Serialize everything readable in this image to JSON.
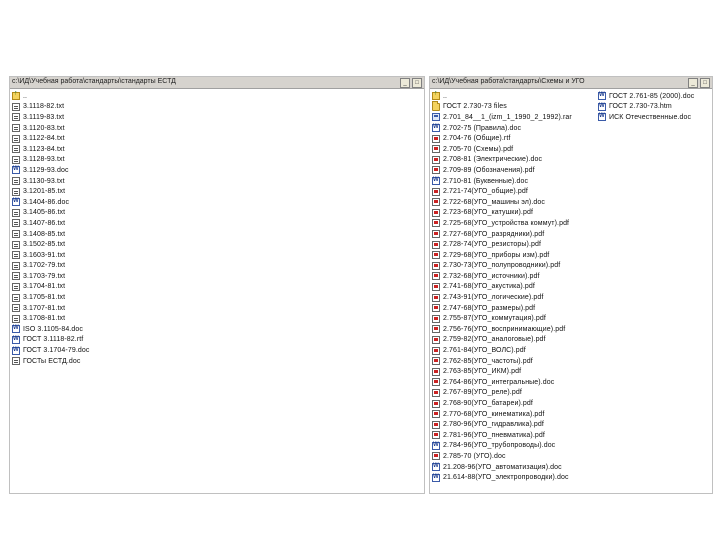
{
  "left_panel": {
    "path": "c:\\ИД\\Учебная работа\\стандарты\\стандарты ЕСТД",
    "items": [
      {
        "name": "..",
        "icon": "up-folder-icon"
      },
      {
        "name": "3.1118-82.txt",
        "icon": "text-file-icon"
      },
      {
        "name": "3.1119-83.txt",
        "icon": "text-file-icon"
      },
      {
        "name": "3.1120-83.txt",
        "icon": "text-file-icon"
      },
      {
        "name": "3.1122-84.txt",
        "icon": "text-file-icon"
      },
      {
        "name": "3.1123-84.txt",
        "icon": "text-file-icon"
      },
      {
        "name": "3.1128-93.txt",
        "icon": "text-file-icon"
      },
      {
        "name": "3.1129-93.doc",
        "icon": "word-doc-icon"
      },
      {
        "name": "3.1130-93.txt",
        "icon": "text-file-icon"
      },
      {
        "name": "3.1201-85.txt",
        "icon": "text-file-icon"
      },
      {
        "name": "3.1404-86.doc",
        "icon": "word-doc-icon"
      },
      {
        "name": "3.1405-86.txt",
        "icon": "text-file-icon"
      },
      {
        "name": "3.1407-86.txt",
        "icon": "text-file-icon"
      },
      {
        "name": "3.1408-85.txt",
        "icon": "text-file-icon"
      },
      {
        "name": "3.1502-85.txt",
        "icon": "text-file-icon"
      },
      {
        "name": "3.1603-91.txt",
        "icon": "text-file-icon"
      },
      {
        "name": "3.1702-79.txt",
        "icon": "text-file-icon"
      },
      {
        "name": "3.1703-79.txt",
        "icon": "text-file-icon"
      },
      {
        "name": "3.1704-81.txt",
        "icon": "text-file-icon"
      },
      {
        "name": "3.1705-81.txt",
        "icon": "text-file-icon"
      },
      {
        "name": "3.1707-81.txt",
        "icon": "text-file-icon"
      },
      {
        "name": "3.1708-81.txt",
        "icon": "text-file-icon"
      },
      {
        "name": "ISO 3.1105-84.doc",
        "icon": "word-doc-icon"
      },
      {
        "name": "ГОСТ 3.1118-82.rtf",
        "icon": "word-doc-icon"
      },
      {
        "name": "ГОСТ 3.1704-79.doc",
        "icon": "word-doc-icon"
      },
      {
        "name": "ГОСТы ЕСТД.doc",
        "icon": "text-file-icon"
      }
    ]
  },
  "right_panel": {
    "path": "c:\\ИД\\Учебная работа\\стандарты\\Схемы и УГО",
    "col1": [
      {
        "name": "..",
        "icon": "up-folder-icon"
      },
      {
        "name": "ГОСТ 2.730-73 files",
        "icon": "folder-icon"
      },
      {
        "name": "2.701_84__1_(izm_1_1990_2_1992).rar",
        "icon": "archive-icon"
      },
      {
        "name": "2.702-75 (Правила).doc",
        "icon": "word-doc-icon"
      },
      {
        "name": "2.704-76 (Общие).rtf",
        "icon": "pdf-icon"
      },
      {
        "name": "2.705-70 (Схемы).pdf",
        "icon": "pdf-icon"
      },
      {
        "name": "2.708-81 (Электрические).doc",
        "icon": "pdf-icon"
      },
      {
        "name": "2.709-89 (Обозначения).pdf",
        "icon": "pdf-icon"
      },
      {
        "name": "2.710-81 (Буквенные).doc",
        "icon": "word-doc-icon"
      },
      {
        "name": "2.721-74(УГО_общие).pdf",
        "icon": "pdf-icon"
      },
      {
        "name": "2.722-68(УГО_машины эл).doc",
        "icon": "pdf-icon"
      },
      {
        "name": "2.723-68(УГО_катушки).pdf",
        "icon": "pdf-icon"
      },
      {
        "name": "2.725-68(УГО_устройства коммут).pdf",
        "icon": "pdf-icon"
      },
      {
        "name": "2.727-68(УГО_разрядники).pdf",
        "icon": "pdf-icon"
      },
      {
        "name": "2.728-74(УГО_резисторы).pdf",
        "icon": "pdf-icon"
      },
      {
        "name": "2.729-68(УГО_приборы изм).pdf",
        "icon": "pdf-icon"
      },
      {
        "name": "2.730-73(УГО_полупроводники).pdf",
        "icon": "pdf-icon"
      },
      {
        "name": "2.732-68(УГО_источники).pdf",
        "icon": "pdf-icon"
      },
      {
        "name": "2.741-68(УГО_акустика).pdf",
        "icon": "pdf-icon"
      },
      {
        "name": "2.743-91(УГО_логические).pdf",
        "icon": "pdf-icon"
      },
      {
        "name": "2.747-68(УГО_размеры).pdf",
        "icon": "pdf-icon"
      },
      {
        "name": "2.755-87(УГО_коммутация).pdf",
        "icon": "pdf-icon"
      },
      {
        "name": "2.756-76(УГО_воспринимающие).pdf",
        "icon": "pdf-icon"
      },
      {
        "name": "2.759-82(УГО_аналоговые).pdf",
        "icon": "pdf-icon"
      },
      {
        "name": "2.761-84(УГО_ВОЛС).pdf",
        "icon": "pdf-icon"
      },
      {
        "name": "2.762-85(УГО_частоты).pdf",
        "icon": "pdf-icon"
      },
      {
        "name": "2.763-85(УГО_ИКМ).pdf",
        "icon": "pdf-icon"
      },
      {
        "name": "2.764-86(УГО_интегральные).doc",
        "icon": "pdf-icon"
      },
      {
        "name": "2.767-89(УГО_реле).pdf",
        "icon": "pdf-icon"
      },
      {
        "name": "2.768-90(УГО_батареи).pdf",
        "icon": "pdf-icon"
      },
      {
        "name": "2.770-68(УГО_кинематика).pdf",
        "icon": "pdf-icon"
      },
      {
        "name": "2.780-96(УГО_гидравлика).pdf",
        "icon": "pdf-icon"
      },
      {
        "name": "2.781-96(УГО_пневматика).pdf",
        "icon": "pdf-icon"
      },
      {
        "name": "2.784-96(УГО_трубопроводы).doc",
        "icon": "word-doc-icon"
      },
      {
        "name": "2.785-70 (УГО).doc",
        "icon": "pdf-icon"
      },
      {
        "name": "21.208-96(УГО_автоматизация).doc",
        "icon": "word-doc-icon"
      },
      {
        "name": "21.614-88(УГО_электропроводки).doc",
        "icon": "word-doc-icon"
      }
    ],
    "col2": [
      {
        "name": "ГОСТ 2.761-85 (2000).doc",
        "icon": "word-doc-icon"
      },
      {
        "name": "ГОСТ 2.730-73.htm",
        "icon": "word-doc-icon"
      },
      {
        "name": "ИСК Отечественные.doc",
        "icon": "word-doc-icon"
      }
    ]
  },
  "colors": {
    "titlebar": "#d6d3ce",
    "panel_border": "#c0c0c0",
    "folder": "#f4d35e",
    "doc_blue": "#3a5aa8",
    "pdf_red": "#cc2222"
  },
  "window_buttons": {
    "minimize": "_",
    "maximize": "□"
  }
}
